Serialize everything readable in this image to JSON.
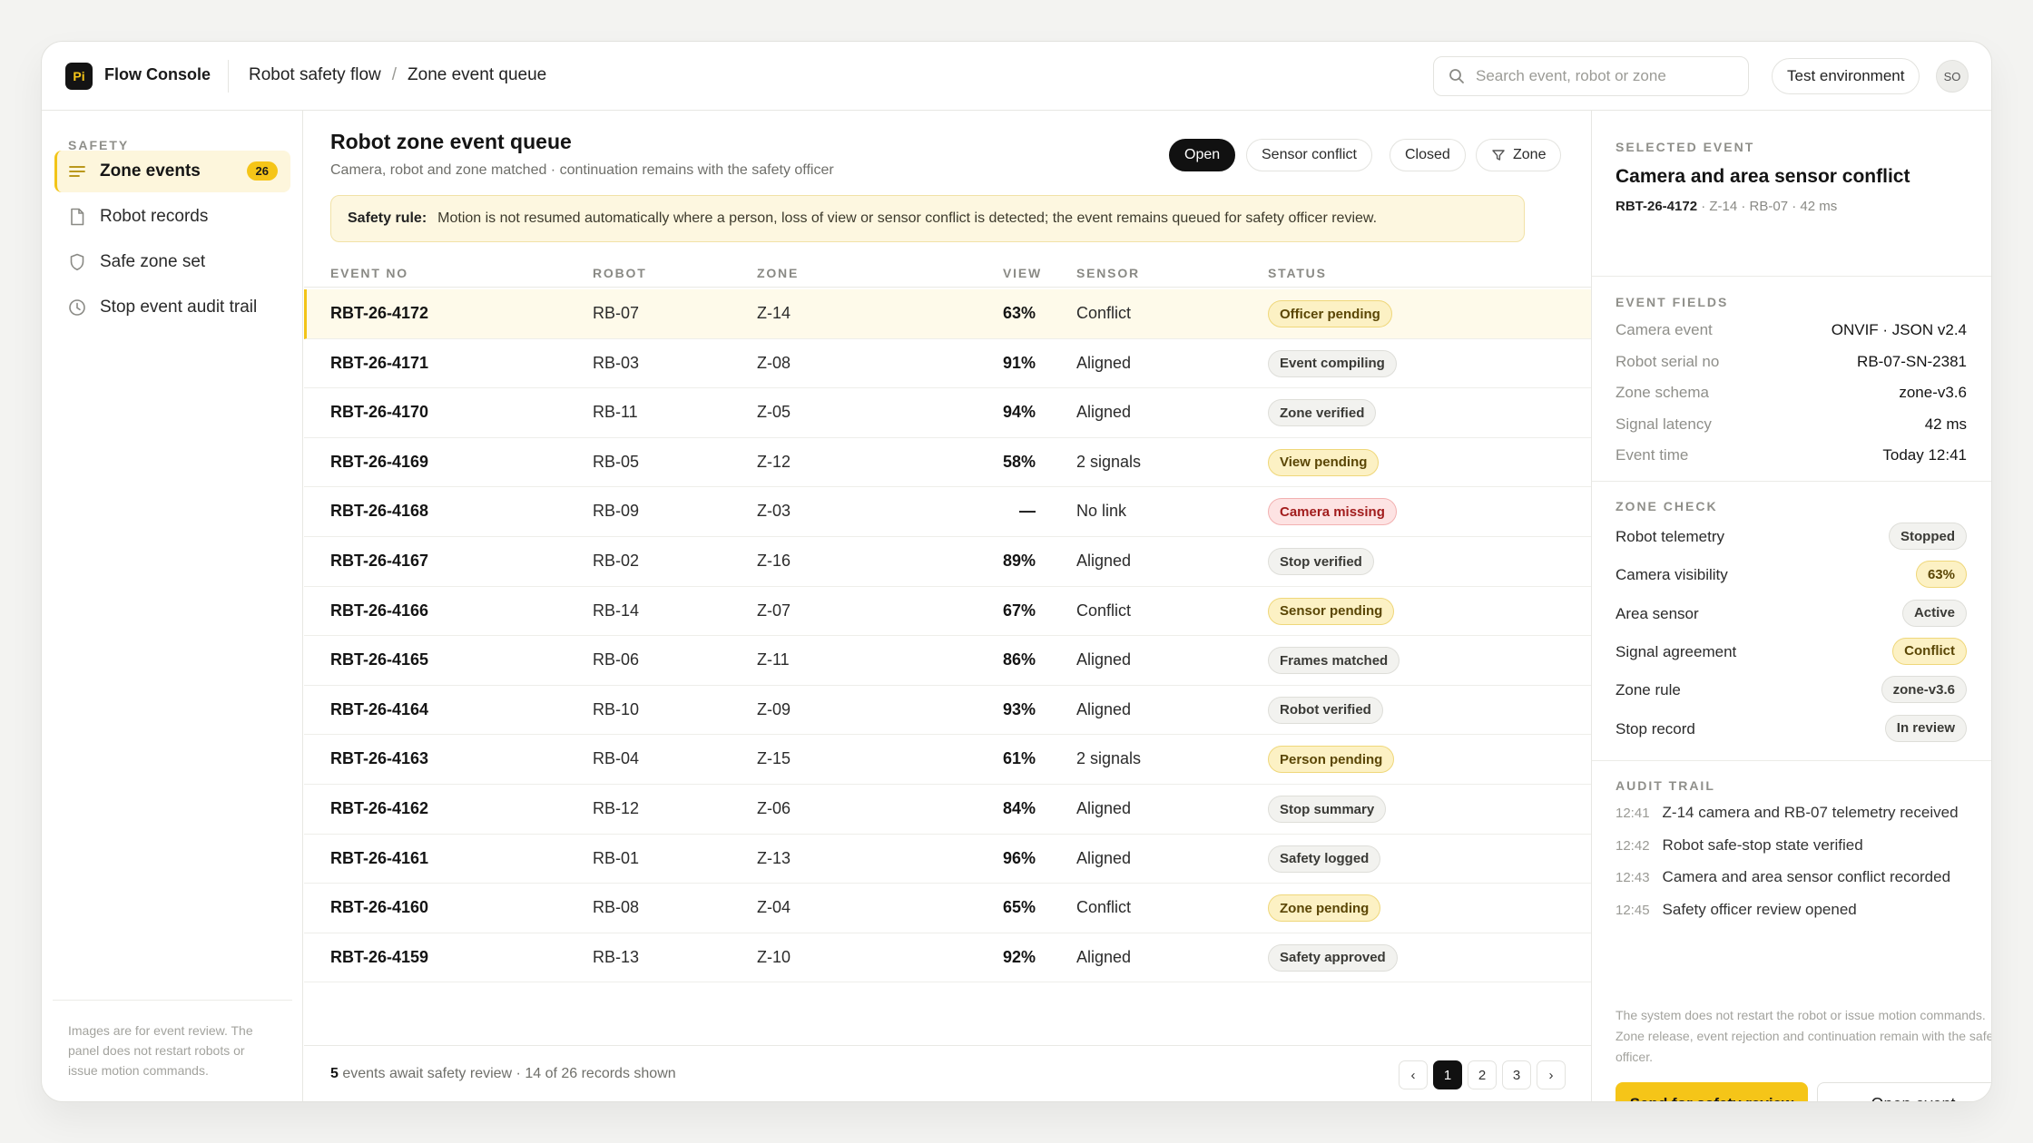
{
  "app": {
    "logo": "Pi",
    "name": "Flow Console"
  },
  "breadcrumb": {
    "parent": "Robot safety flow",
    "sep": "/",
    "current": "Zone event queue"
  },
  "search": {
    "placeholder": "Search event, robot or zone",
    "icon": "search-icon"
  },
  "environment": "Test environment",
  "user": {
    "initials": "SO"
  },
  "sidebar": {
    "heading": "SAFETY",
    "items": [
      {
        "label": "Zone events",
        "icon": "list-icon",
        "badge": "26",
        "active": true
      },
      {
        "label": "Robot records",
        "icon": "document-icon"
      },
      {
        "label": "Safe zone set",
        "icon": "shield-icon"
      },
      {
        "label": "Stop event audit trail",
        "icon": "clock-icon"
      }
    ],
    "note": "Images are for event review. The panel does not restart robots or issue motion commands."
  },
  "main": {
    "title": "Robot zone event queue",
    "subtitle": "Camera, robot and zone matched · continuation remains with the safety officer",
    "filters": [
      {
        "label": "Open",
        "active": true
      },
      {
        "label": "Sensor conflict"
      },
      {
        "label": "Closed"
      },
      {
        "label": "Zone",
        "icon": "filter-icon"
      }
    ],
    "rule": {
      "label": "Safety rule:",
      "text": "Motion is not resumed automatically where a person, loss of view or sensor conflict is detected; the event remains queued for safety officer review."
    },
    "columns": [
      "EVENT NO",
      "ROBOT",
      "ZONE",
      "VIEW",
      "SENSOR",
      "STATUS"
    ],
    "rows": [
      {
        "id": "RBT-26-4172",
        "robot": "RB-07",
        "zone": "Z-14",
        "view": "63%",
        "sensor": "Conflict",
        "status": "Officer pending",
        "tone": "yellow"
      },
      {
        "id": "RBT-26-4171",
        "robot": "RB-03",
        "zone": "Z-08",
        "view": "91%",
        "sensor": "Aligned",
        "status": "Event compiling",
        "tone": "gray"
      },
      {
        "id": "RBT-26-4170",
        "robot": "RB-11",
        "zone": "Z-05",
        "view": "94%",
        "sensor": "Aligned",
        "status": "Zone verified",
        "tone": "gray"
      },
      {
        "id": "RBT-26-4169",
        "robot": "RB-05",
        "zone": "Z-12",
        "view": "58%",
        "sensor": "2 signals",
        "status": "View pending",
        "tone": "yellow"
      },
      {
        "id": "RBT-26-4168",
        "robot": "RB-09",
        "zone": "Z-03",
        "view": "—",
        "sensor": "No link",
        "status": "Camera missing",
        "tone": "red"
      },
      {
        "id": "RBT-26-4167",
        "robot": "RB-02",
        "zone": "Z-16",
        "view": "89%",
        "sensor": "Aligned",
        "status": "Stop verified",
        "tone": "gray"
      },
      {
        "id": "RBT-26-4166",
        "robot": "RB-14",
        "zone": "Z-07",
        "view": "67%",
        "sensor": "Conflict",
        "status": "Sensor pending",
        "tone": "yellow"
      },
      {
        "id": "RBT-26-4165",
        "robot": "RB-06",
        "zone": "Z-11",
        "view": "86%",
        "sensor": "Aligned",
        "status": "Frames matched",
        "tone": "gray"
      },
      {
        "id": "RBT-26-4164",
        "robot": "RB-10",
        "zone": "Z-09",
        "view": "93%",
        "sensor": "Aligned",
        "status": "Robot verified",
        "tone": "gray"
      },
      {
        "id": "RBT-26-4163",
        "robot": "RB-04",
        "zone": "Z-15",
        "view": "61%",
        "sensor": "2 signals",
        "status": "Person pending",
        "tone": "yellow"
      },
      {
        "id": "RBT-26-4162",
        "robot": "RB-12",
        "zone": "Z-06",
        "view": "84%",
        "sensor": "Aligned",
        "status": "Stop summary",
        "tone": "gray"
      },
      {
        "id": "RBT-26-4161",
        "robot": "RB-01",
        "zone": "Z-13",
        "view": "96%",
        "sensor": "Aligned",
        "status": "Safety logged",
        "tone": "gray"
      },
      {
        "id": "RBT-26-4160",
        "robot": "RB-08",
        "zone": "Z-04",
        "view": "65%",
        "sensor": "Conflict",
        "status": "Zone pending",
        "tone": "yellow"
      },
      {
        "id": "RBT-26-4159",
        "robot": "RB-13",
        "zone": "Z-10",
        "view": "92%",
        "sensor": "Aligned",
        "status": "Safety approved",
        "tone": "gray"
      }
    ],
    "footer": {
      "count": "5",
      "text": "events await safety review · 14 of 26 records shown"
    },
    "pagination": {
      "prev": "‹",
      "pages": [
        "1",
        "2",
        "3"
      ],
      "current": "1",
      "next": "›"
    }
  },
  "panel": {
    "selected_heading": "SELECTED EVENT",
    "title": "Camera and area sensor conflict",
    "event_id": "RBT-26-4172",
    "meta": "· Z-14 · RB-07 · 42 ms",
    "fields_heading": "EVENT FIELDS",
    "fields": [
      {
        "k": "Camera event",
        "v": "ONVIF · JSON v2.4"
      },
      {
        "k": "Robot serial no",
        "v": "RB-07-SN-2381"
      },
      {
        "k": "Zone schema",
        "v": "zone-v3.6"
      },
      {
        "k": "Signal latency",
        "v": "42 ms"
      },
      {
        "k": "Event time",
        "v": "Today 12:41"
      }
    ],
    "check_heading": "ZONE CHECK",
    "checks": [
      {
        "k": "Robot telemetry",
        "v": "Stopped",
        "tone": "gray"
      },
      {
        "k": "Camera visibility",
        "v": "63%",
        "tone": "yellow"
      },
      {
        "k": "Area sensor",
        "v": "Active",
        "tone": "gray"
      },
      {
        "k": "Signal agreement",
        "v": "Conflict",
        "tone": "yellow"
      },
      {
        "k": "Zone rule",
        "v": "zone-v3.6",
        "tone": "gray"
      },
      {
        "k": "Stop record",
        "v": "In review",
        "tone": "gray"
      }
    ],
    "audit_heading": "AUDIT TRAIL",
    "audit": [
      {
        "t": "12:41",
        "text": "Z-14 camera and RB-07 telemetry received"
      },
      {
        "t": "12:42",
        "text": "Robot safe-stop state verified"
      },
      {
        "t": "12:43",
        "text": "Camera and area sensor conflict recorded"
      },
      {
        "t": "12:45",
        "text": "Safety officer review opened"
      }
    ],
    "note": "The system does not restart the robot or issue motion commands. Zone release, event rejection and continuation remain with the safety officer.",
    "primary_button": "Send for safety review",
    "secondary_button": "Open event"
  },
  "colors": {
    "accent": "#f5c518",
    "dark": "#111111",
    "danger": "#a21d1d"
  }
}
